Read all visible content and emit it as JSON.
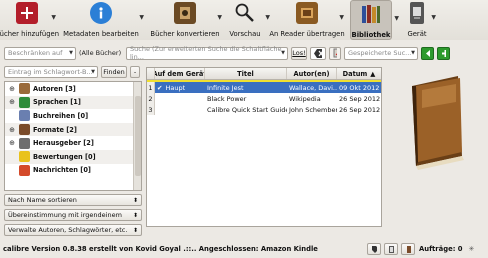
{
  "toolbar": {
    "items": [
      {
        "label": "Bücher hinzufügen",
        "icon": "add-book-icon"
      },
      {
        "label": "Metadaten bearbeiten",
        "icon": "info-icon"
      },
      {
        "label": "Bücher konvertieren",
        "icon": "convert-book-icon"
      },
      {
        "label": "Vorschau",
        "icon": "magnifier-icon"
      },
      {
        "label": "An Reader übertragen",
        "icon": "send-to-device-icon"
      },
      {
        "label": "Bibliothek",
        "icon": "library-icon"
      },
      {
        "label": "Gerät",
        "icon": "ebook-reader-icon"
      }
    ]
  },
  "search": {
    "restrict_placeholder": "Beschränken auf",
    "all_books": "(Alle Bücher)",
    "search_placeholder": "Suche (Zur erweiterten Suche die Schaltfläche lin...",
    "go_button": "Los!",
    "saved_search_placeholder": "Gespeicherte Suc..."
  },
  "tag_browser": {
    "search_placeholder": "Eintrag im Schlagwort-B...",
    "find_button": "Finden",
    "collapse_button": "-",
    "categories": [
      {
        "label": "Autoren [3]",
        "icon": "authors-icon",
        "color": "#9a6a3a",
        "expandable": true
      },
      {
        "label": "Sprachen [1]",
        "icon": "languages-icon",
        "color": "#2f8c3a",
        "expandable": true
      },
      {
        "label": "Buchreihen [0]",
        "icon": "series-icon",
        "color": "#6a7fb0",
        "expandable": false
      },
      {
        "label": "Formate [2]",
        "icon": "formats-icon",
        "color": "#7a4b2a",
        "expandable": true
      },
      {
        "label": "Herausgeber [2]",
        "icon": "publisher-icon",
        "color": "#6e6e6e",
        "expandable": true
      },
      {
        "label": "Bewertungen [0]",
        "icon": "rating-star-icon",
        "color": "#e9c21c",
        "expandable": false
      },
      {
        "label": "Nachrichten [0]",
        "icon": "news-icon",
        "color": "#d44a2a",
        "expandable": false
      }
    ],
    "sort_by": "Nach Name sortieren",
    "match_mode": "Übereinstimmung mit irgendeinem",
    "manage": "Verwalte Autoren, Schlagwörter, etc."
  },
  "book_list": {
    "columns": [
      "Auf dem Gerät",
      "Titel",
      "Autor(en)",
      "Datum"
    ],
    "rows": [
      {
        "num": "1",
        "device": "Haupt",
        "title": "Infinite Jest",
        "author": "Wallace, Davi...",
        "date": "09 Okt 2012",
        "on_device": true
      },
      {
        "num": "2",
        "device": "",
        "title": "Black Power",
        "author": "Wikipedia",
        "date": "26 Sep 2012",
        "on_device": false
      },
      {
        "num": "3",
        "device": "",
        "title": "Calibre Quick Start Guide",
        "author": "John Schember",
        "date": "26 Sep 2012",
        "on_device": false
      }
    ]
  },
  "status": {
    "text": "calibre Version 0.8.38 erstellt von Kovid Goyal .::.. Angeschlossen: Amazon Kindle",
    "jobs": "Aufträge: 0"
  },
  "colors": {
    "selection": "#3a6fc0",
    "accent_green": "#2e9a2e"
  }
}
